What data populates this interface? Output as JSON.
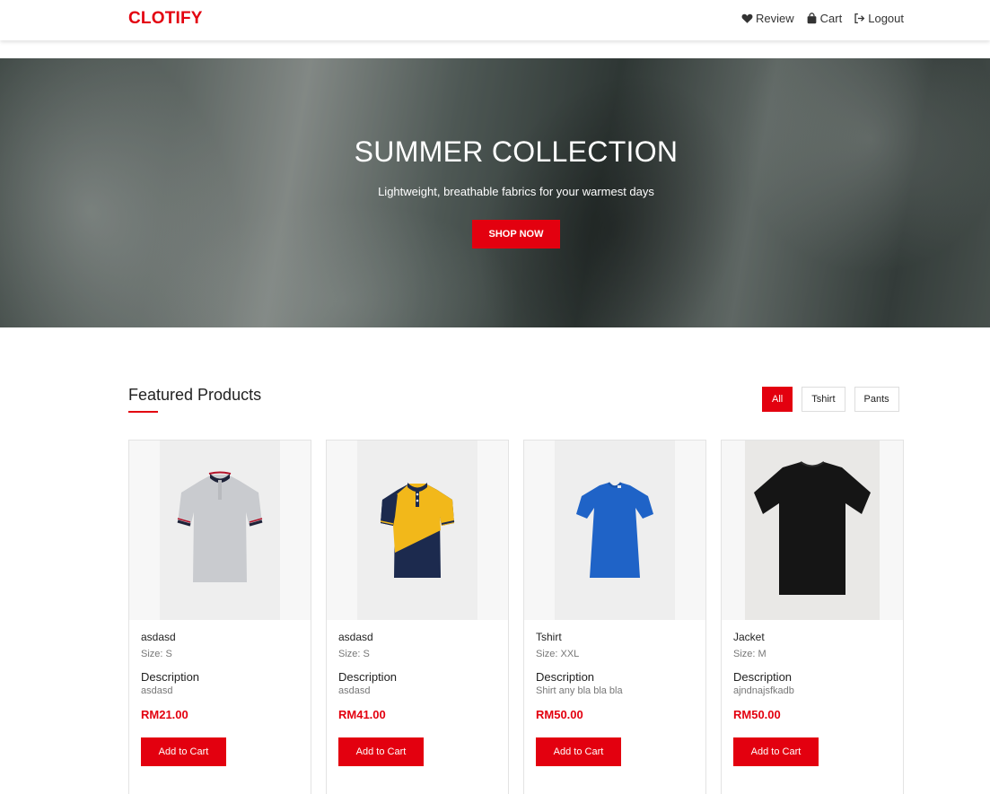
{
  "brand": "CLOTIFY",
  "nav": {
    "review": "Review",
    "cart": "Cart",
    "logout": "Logout"
  },
  "hero": {
    "title": "SUMMER COLLECTION",
    "subtitle": "Lightweight, breathable fabrics for your warmest days",
    "button": "SHOP NOW"
  },
  "featured": {
    "title": "Featured Products",
    "filters": [
      "All",
      "Tshirt",
      "Pants"
    ],
    "active_filter": "All"
  },
  "products": [
    {
      "name": "asdasd",
      "size": "Size: S",
      "desc_label": "Description",
      "desc": "asdasd",
      "price": "RM21.00",
      "button": "Add to Cart",
      "image": "grey-polo-shirt"
    },
    {
      "name": "asdasd",
      "size": "Size: S",
      "desc_label": "Description",
      "desc": "asdasd",
      "price": "RM41.00",
      "button": "Add to Cart",
      "image": "navy-yellow-polo-shirt"
    },
    {
      "name": "Tshirt",
      "size": "Size: XXL",
      "desc_label": "Description",
      "desc": "Shirt any bla bla bla",
      "price": "RM50.00",
      "button": "Add to Cart",
      "image": "blue-tshirt"
    },
    {
      "name": "Jacket",
      "size": "Size: M",
      "desc_label": "Description",
      "desc": "ajndnajsfkadb",
      "price": "RM50.00",
      "button": "Add to Cart",
      "image": "black-tshirt"
    }
  ],
  "colors": {
    "accent": "#e3000f"
  }
}
